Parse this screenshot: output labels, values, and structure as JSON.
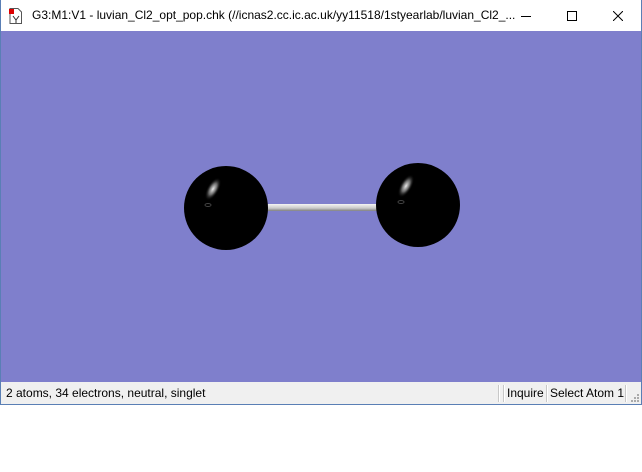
{
  "window": {
    "title": "G3:M1:V1 - luvian_Cl2_opt_pop.chk (//icnas2.cc.ic.ac.uk/yy11518/1styearlab/luvian_Cl2_...",
    "controls": [
      "minimize-icon",
      "maximize-icon",
      "close-icon"
    ]
  },
  "viewport": {
    "background": "#7f7fcc",
    "atom_color": "#000000",
    "bond_color": "#d8d8d8"
  },
  "statusbar": {
    "summary": "2 atoms, 34 electrons, neutral, singlet",
    "mode": "Inquire",
    "action": "Select Atom 1"
  }
}
